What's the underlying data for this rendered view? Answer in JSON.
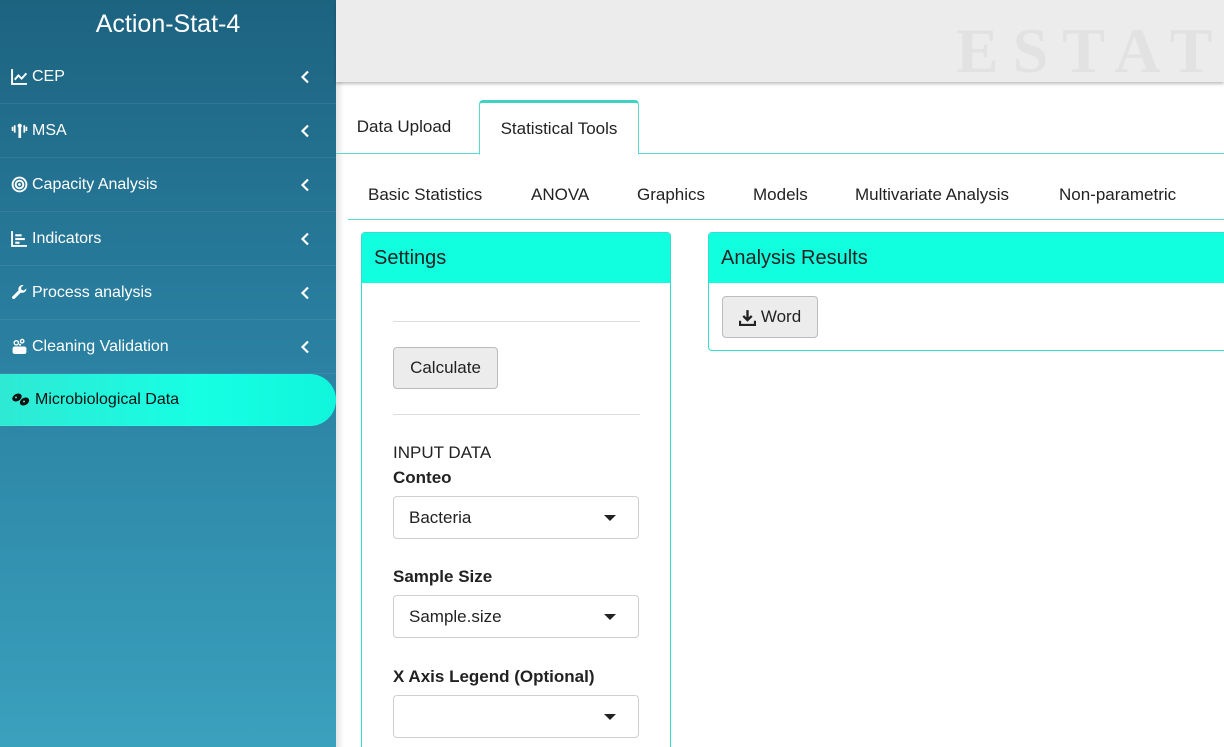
{
  "app": {
    "title": "Action-Stat-4",
    "header_watermark": "ESTAT"
  },
  "sidebar": {
    "items": [
      {
        "label": "CEP",
        "icon": "line-chart-icon"
      },
      {
        "label": "MSA",
        "icon": "signal-tower-icon"
      },
      {
        "label": "Capacity Analysis",
        "icon": "bullseye-icon"
      },
      {
        "label": "Indicators",
        "icon": "bar-chart-icon"
      },
      {
        "label": "Process analysis",
        "icon": "wrench-icon"
      },
      {
        "label": "Cleaning Validation",
        "icon": "soap-icon"
      },
      {
        "label": "Microbiological Data",
        "icon": "bacteria-icon"
      }
    ]
  },
  "main_tabs": [
    "Data Upload",
    "Statistical Tools"
  ],
  "sub_tabs": [
    "Basic Statistics",
    "ANOVA",
    "Graphics",
    "Models",
    "Multivariate Analysis",
    "Non-parametric"
  ],
  "settings": {
    "title": "Settings",
    "calculate_label": "Calculate",
    "input_data_heading": "INPUT DATA",
    "conteo_label": "Conteo",
    "conteo_value": "Bacteria",
    "sample_size_label": "Sample Size",
    "sample_size_value": "Sample.size",
    "x_axis_label": "X Axis Legend (Optional)",
    "x_axis_value": ""
  },
  "results": {
    "title": "Analysis Results",
    "word_label": "Word"
  },
  "colors": {
    "accent": "#12ffdf",
    "sidebar_top": "#1c6380",
    "sidebar_bottom": "#3aa1bd"
  }
}
